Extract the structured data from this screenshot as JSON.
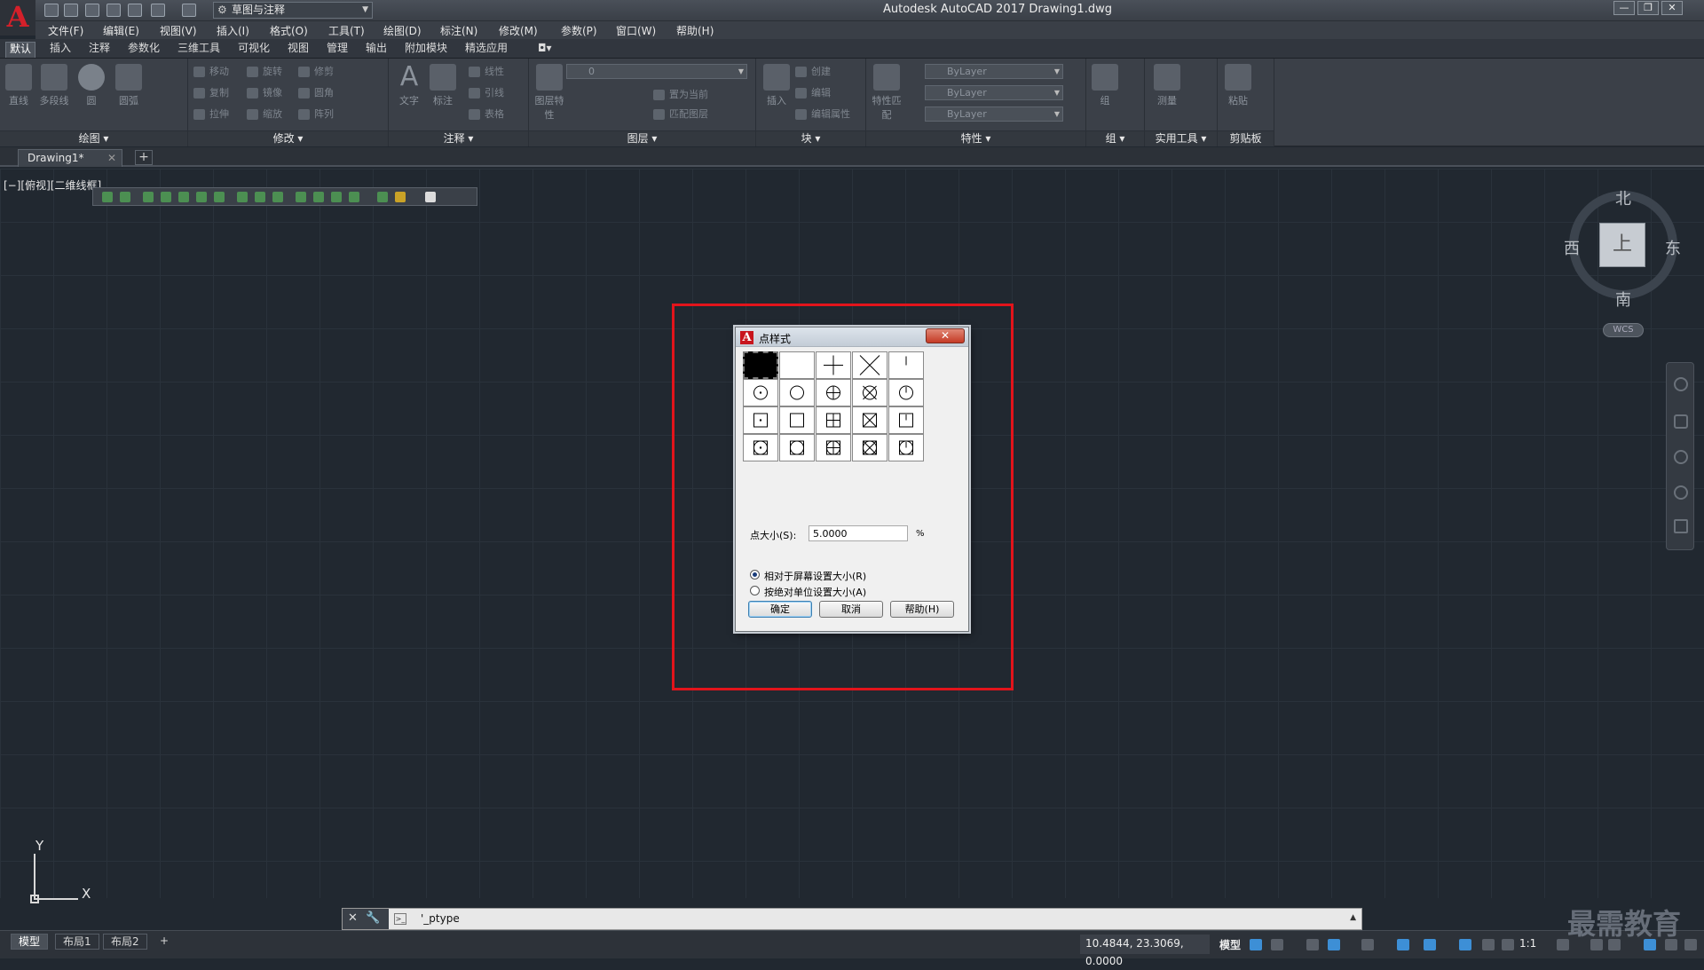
{
  "titlebar": {
    "app_logo": "A",
    "workspace": "草图与注释",
    "title": "Autodesk AutoCAD 2017    Drawing1.dwg",
    "window_controls": [
      "—",
      "❐",
      "✕"
    ]
  },
  "menubar": {
    "items": [
      "文件(F)",
      "编辑(E)",
      "视图(V)",
      "插入(I)",
      "格式(O)",
      "工具(T)",
      "绘图(D)",
      "标注(N)",
      "修改(M)",
      "参数(P)",
      "窗口(W)",
      "帮助(H)"
    ]
  },
  "ribbon": {
    "tabs": [
      "默认",
      "插入",
      "注释",
      "参数化",
      "三维工具",
      "可视化",
      "视图",
      "管理",
      "输出",
      "附加模块",
      "精选应用"
    ],
    "active_tab": "默认",
    "panels": [
      "绘图 ▾",
      "修改 ▾",
      "注释 ▾",
      "图层 ▾",
      "块 ▾",
      "特性 ▾",
      "组 ▾",
      "实用工具 ▾",
      "剪贴板"
    ],
    "draw_tools": [
      "直线",
      "多段线",
      "圆",
      "圆弧"
    ],
    "modify_tools": [
      "移动",
      "旋转",
      "修剪",
      "复制",
      "镜像",
      "圆角",
      "拉伸",
      "缩放",
      "阵列"
    ],
    "annotation_tools": [
      "文字",
      "标注",
      "线性",
      "引线",
      "表格"
    ],
    "layer_tools": [
      "图层特性",
      "置为当前",
      "匹配图层"
    ],
    "layer_value": "0",
    "block_tools": [
      "插入",
      "创建",
      "编辑",
      "编辑属性"
    ],
    "properties": {
      "match_label": "特性匹配",
      "color": "ByLayer",
      "linetype": "ByLayer",
      "lineweight": "ByLayer"
    },
    "group_label": "组",
    "utilities_label": "测量",
    "clipboard_label": "粘贴"
  },
  "doc_tabs": {
    "active": "Drawing1*",
    "close": "✕",
    "add": "+"
  },
  "viewport_label": "[−][俯视][二维线框]",
  "viewcube": {
    "top": "上",
    "north": "北",
    "south": "南",
    "east": "东",
    "west": "西",
    "wcs": "WCS"
  },
  "ucs": {
    "x": "X",
    "y": "Y"
  },
  "dialog": {
    "title": "点样式",
    "close": "✕",
    "styles": [
      "dot",
      "none",
      "plus",
      "cross",
      "tick",
      "circle-dot",
      "circle",
      "circle-plus",
      "circle-cross",
      "circle-tick",
      "square-dot",
      "square",
      "square-plus",
      "square-cross",
      "square-tick",
      "circle-square-dot",
      "circle-square",
      "circle-square-plus",
      "circle-square-cross",
      "circle-square-tick"
    ],
    "selected_index": 0,
    "size_label": "点大小(S):",
    "size_value": "5.0000",
    "size_unit": "%",
    "radio_relative": "相对于屏幕设置大小(R)",
    "radio_absolute": "按绝对单位设置大小(A)",
    "ok": "确定",
    "cancel": "取消",
    "help": "帮助(H)"
  },
  "cmdline": {
    "text": "'_ptype"
  },
  "statusbar": {
    "layout_tabs": [
      "模型",
      "布局1",
      "布局2"
    ],
    "add_tab": "+",
    "coords": "10.4844, 23.3069, 0.0000",
    "mode": "模型",
    "scale": "1:1"
  },
  "watermark": "最需教育"
}
